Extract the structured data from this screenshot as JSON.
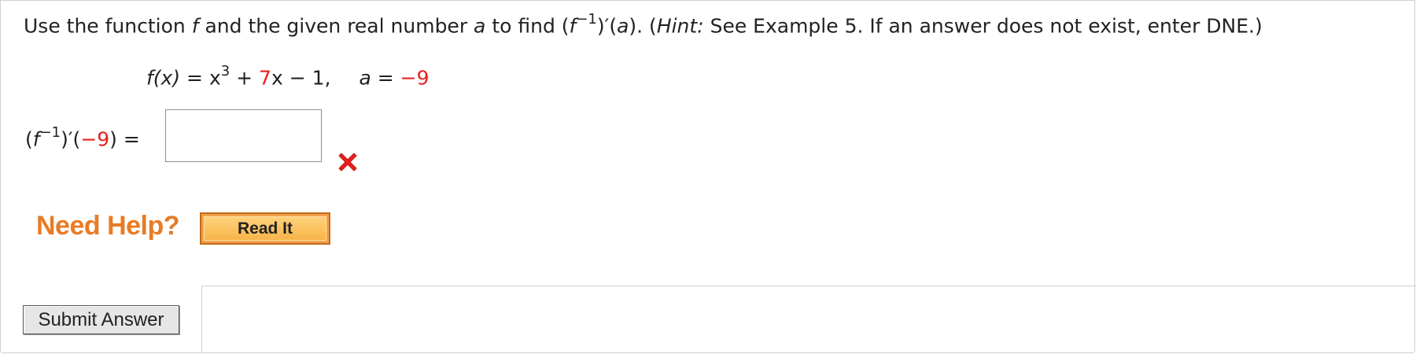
{
  "question": {
    "intro": "Use the function ",
    "f": "f",
    "mid1": " and the given real number ",
    "a": "a",
    "mid2": " to find (",
    "f2": "f",
    "sup": "−1",
    "mid3": ")′(",
    "a2": "a",
    "mid4": "). (",
    "hint_label": "Hint:",
    "hint_text": " See Example 5. If an answer does not exist, enter DNE.)"
  },
  "formula": {
    "lhs": "f(x)",
    "eq": " = x",
    "exp": "3",
    "plus": " + ",
    "coef": "7",
    "rest": "x − 1,",
    "a_label": "a",
    "a_eq": " = ",
    "a_value": "−9"
  },
  "answer": {
    "open": "(",
    "f": "f",
    "sup": "−1",
    "close": ")′(",
    "value": "−9",
    "end": ") =",
    "input_value": "",
    "input_placeholder": ""
  },
  "status": {
    "icon": "x-mark-icon",
    "color": "#e8201c"
  },
  "help": {
    "label": "Need Help?",
    "read_it": "Read It"
  },
  "submit": {
    "label": "Submit Answer"
  }
}
